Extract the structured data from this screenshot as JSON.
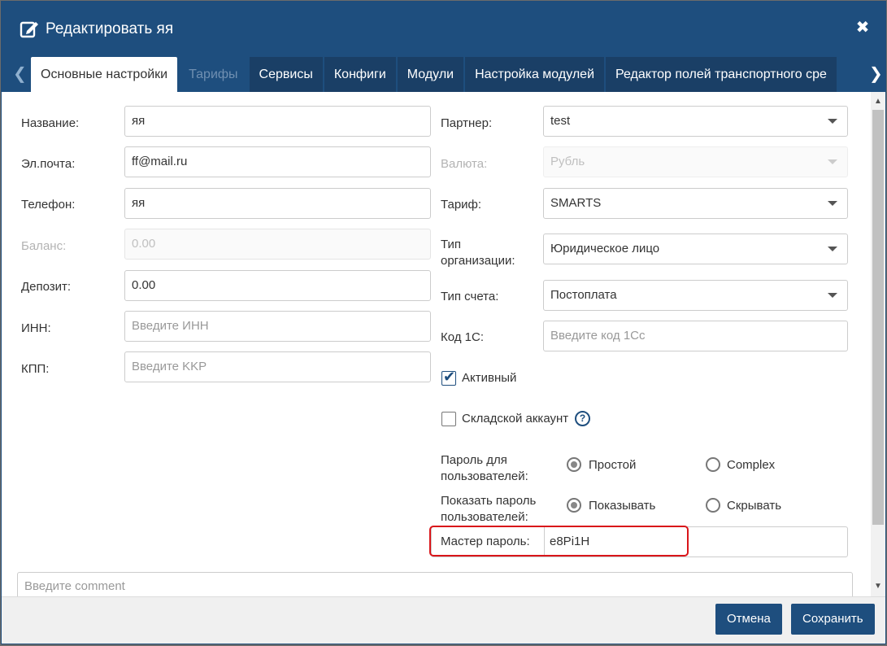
{
  "dialog": {
    "title": "Редактировать яя",
    "close_icon": "close-icon",
    "edit_icon": "edit-icon"
  },
  "tabs": [
    {
      "label": "Основные настройки",
      "state": "active"
    },
    {
      "label": "Тарифы",
      "state": "disabled"
    },
    {
      "label": "Сервисы",
      "state": "normal"
    },
    {
      "label": "Конфиги",
      "state": "normal"
    },
    {
      "label": "Модули",
      "state": "normal"
    },
    {
      "label": "Настройка модулей",
      "state": "normal"
    },
    {
      "label": "Редактор полей транспортного сре",
      "state": "normal"
    }
  ],
  "left_form": {
    "name": {
      "label": "Название:",
      "value": "яя"
    },
    "email": {
      "label": "Эл.почта:",
      "value": "ff@mail.ru"
    },
    "phone": {
      "label": "Телефон:",
      "value": "яя"
    },
    "balance": {
      "label": "Баланс:",
      "value": "0.00"
    },
    "deposit": {
      "label": "Депозит:",
      "value": "0.00"
    },
    "inn": {
      "label": "ИНН:",
      "placeholder": "Введите ИНН"
    },
    "kpp": {
      "label": "КПП:",
      "placeholder": "Введите KKP"
    }
  },
  "right_form": {
    "partner": {
      "label": "Партнер:",
      "value": "test"
    },
    "currency": {
      "label": "Валюта:",
      "value": "Рубль"
    },
    "tariff": {
      "label": "Тариф:",
      "value": "SMARTS"
    },
    "org_type": {
      "label_line1": "Тип",
      "label_line2": "организации:",
      "value": "Юридическое лицо"
    },
    "account_type": {
      "label": "Тип счета:",
      "value": "Постоплата"
    },
    "code_1c": {
      "label": "Код 1С:",
      "placeholder": "Введите код 1Сс"
    },
    "active": {
      "label": "Активный",
      "checked": true
    },
    "warehouse": {
      "label": "Складской аккаунт",
      "checked": false,
      "help": "?"
    },
    "password_mode": {
      "label_line1": "Пароль для",
      "label_line2": "пользователей:",
      "opt1": "Простой",
      "opt2": "Complex",
      "selected": "Простой"
    },
    "show_password": {
      "label_line1": "Показать пароль",
      "label_line2": "пользователей:",
      "opt1": "Показывать",
      "opt2": "Скрывать",
      "selected": "Показывать"
    },
    "master_password": {
      "label": "Мастер пароль:",
      "value": "e8Pi1H"
    }
  },
  "comment": {
    "placeholder": "Введите comment"
  },
  "footer": {
    "cancel": "Отмена",
    "save": "Сохранить"
  },
  "colors": {
    "header": "#1e4e7e",
    "highlight": "#d9151a"
  }
}
